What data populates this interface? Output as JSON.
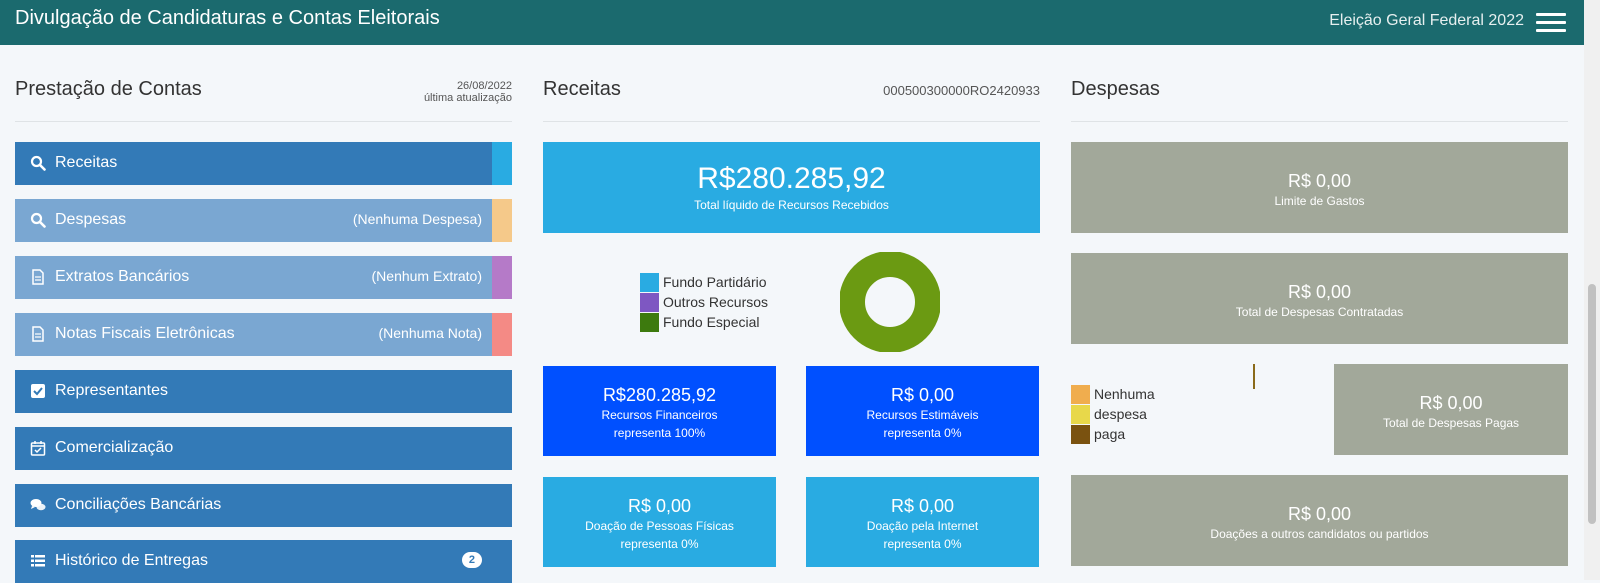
{
  "header": {
    "title": "Divulgação de Candidaturas e Contas Eleitorais",
    "election": "Eleição Geral Federal 2022"
  },
  "left": {
    "title": "Prestação de Contas",
    "date": "26/08/2022",
    "date_label": "última atualização",
    "items": [
      {
        "label": "Receitas",
        "note": "",
        "icon": "search-icon",
        "stripe": "#29abe2"
      },
      {
        "label": "Despesas",
        "note": "(Nenhuma Despesa)",
        "icon": "search-icon",
        "stripe": "#f5c98a"
      },
      {
        "label": "Extratos Bancários",
        "note": "(Nenhum Extrato)",
        "icon": "document-icon",
        "stripe": "#b57ac8"
      },
      {
        "label": "Notas Fiscais Eletrônicas",
        "note": "(Nenhuma Nota)",
        "icon": "document-icon",
        "stripe": "#f48a85"
      },
      {
        "label": "Representantes",
        "icon": "checkbox-icon"
      },
      {
        "label": "Comercialização",
        "icon": "calendar-check-icon"
      },
      {
        "label": "Conciliações Bancárias",
        "icon": "comments-icon"
      },
      {
        "label": "Histórico de Entregas",
        "icon": "list-icon",
        "badge": "2"
      }
    ]
  },
  "receitas": {
    "title": "Receitas",
    "code": "000500300000RO2420933",
    "total_value": "R$280.285,92",
    "total_label": "Total líquido de Recursos Recebidos",
    "legend": [
      {
        "label": "Fundo Partidário",
        "color": "#29abe2"
      },
      {
        "label": "Outros Recursos",
        "color": "#7e57c2"
      },
      {
        "label": "Fundo Especial",
        "color": "#3d7a0e"
      }
    ],
    "donut_color": "#6b9a12",
    "financeiros": {
      "value": "R$280.285,92",
      "label": "Recursos Financeiros",
      "pct": "representa 100%"
    },
    "estimaveis": {
      "value": "R$ 0,00",
      "label": "Recursos Estimáveis",
      "pct": "representa 0%"
    },
    "pf": {
      "value": "R$ 0,00",
      "label": "Doação de Pessoas Físicas",
      "pct": "representa 0%"
    },
    "internet": {
      "value": "R$ 0,00",
      "label": "Doação pela Internet",
      "pct": "representa 0%"
    }
  },
  "despesas": {
    "title": "Despesas",
    "limite": {
      "value": "R$ 0,00",
      "label": "Limite de Gastos"
    },
    "contratadas": {
      "value": "R$ 0,00",
      "label": "Total de Despesas Contratadas"
    },
    "legend": [
      {
        "label": "Nenhuma",
        "color": "#f0ad4e"
      },
      {
        "label": "despesa",
        "color": "#e8d84a"
      },
      {
        "label": "paga",
        "color": "#7a5210"
      }
    ],
    "pagas": {
      "value": "R$ 0,00",
      "label": "Total de Despesas Pagas"
    },
    "doacoes": {
      "value": "R$ 0,00",
      "label": "Doações a outros candidatos ou partidos"
    }
  }
}
